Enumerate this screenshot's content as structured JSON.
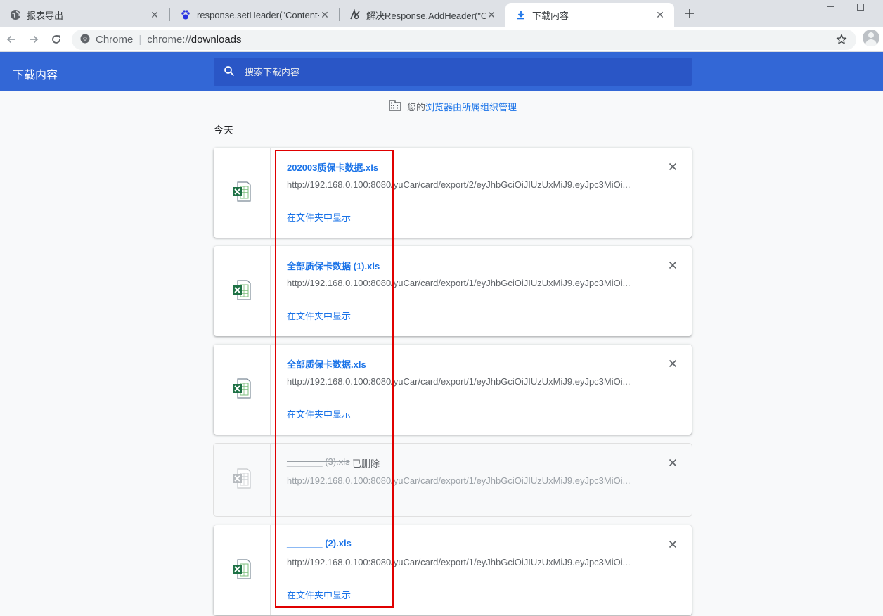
{
  "tabs": [
    {
      "title": "报表导出",
      "icon": "globe-icon",
      "active": false
    },
    {
      "title": "response.setHeader(\"Content-",
      "icon": "baidu-paw-icon",
      "active": false
    },
    {
      "title": "解决Response.AddHeader(\"Co",
      "icon": "script-icon",
      "active": false
    },
    {
      "title": "下载内容",
      "icon": "download-icon",
      "active": true
    }
  ],
  "omnibox": {
    "site_chip": "Chrome",
    "url_scheme": "chrome://",
    "url_path": "downloads"
  },
  "header": {
    "title": "下载内容",
    "search_placeholder": "搜索下载内容"
  },
  "managed": {
    "prefix": "您的",
    "link": "浏览器由所属组织管理"
  },
  "section_date": "今天",
  "downloads": [
    {
      "name": "202003质保卡数据.xls",
      "url": "http://192.168.0.100:8080/yuCar/card/export/2/eyJhbGciOiJIUzUxMiJ9.eyJpc3MiOi...",
      "action": "在文件夹中显示",
      "removed": false
    },
    {
      "name": "全部质保卡数据 (1).xls",
      "url": "http://192.168.0.100:8080/yuCar/card/export/1/eyJhbGciOiJIUzUxMiJ9.eyJpc3MiOi...",
      "action": "在文件夹中显示",
      "removed": false
    },
    {
      "name": "全部质保卡数据.xls",
      "url": "http://192.168.0.100:8080/yuCar/card/export/1/eyJhbGciOiJIUzUxMiJ9.eyJpc3MiOi...",
      "action": "在文件夹中显示",
      "removed": false
    },
    {
      "name": "_______ (3).xls",
      "url": "http://192.168.0.100:8080/yuCar/card/export/1/eyJhbGciOiJIUzUxMiJ9.eyJpc3MiOi...",
      "status": "已删除",
      "removed": true
    },
    {
      "name": "_______ (2).xls",
      "url": "http://192.168.0.100:8080/yuCar/card/export/1/eyJhbGciOiJIUzUxMiJ9.eyJpc3MiOi...",
      "action": "在文件夹中显示",
      "removed": false
    }
  ],
  "colors": {
    "header_bg": "#3367d6",
    "search_bg": "#2a56c6",
    "link": "#1a73e8",
    "annotation": "#e00000"
  }
}
